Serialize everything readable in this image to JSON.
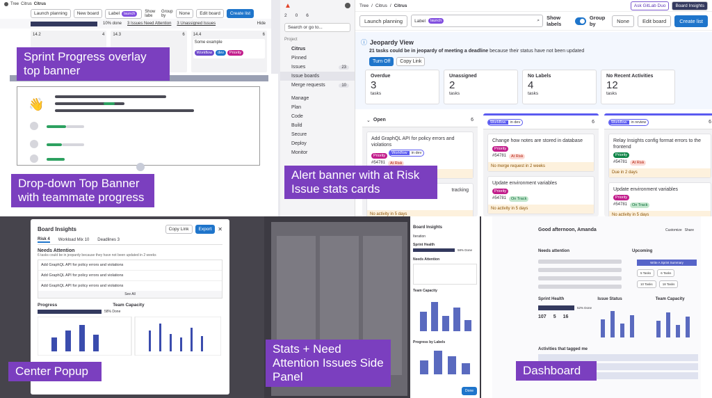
{
  "captions": {
    "sprint": "Sprint Progress overlay top banner",
    "dropdown": "Drop-down Top Banner with teammate progress",
    "alert": "Alert banner with at Risk Issue stats cards",
    "popup": "Center Popup",
    "side": "Stats + Need Attention Issues Side Panel",
    "dashboard": "Dashboard"
  },
  "sprint_tile": {
    "breadcrumb": [
      "Tree",
      "Citrus",
      "Citrus"
    ],
    "launch": "Launch planning",
    "new_board": "New board",
    "label_filter": "Label",
    "label_value": "launch",
    "show_labels": "Show labels",
    "group_by": "Group by",
    "none": "None",
    "edit_board": "Edit board",
    "create_list": "Create list",
    "progress": "10% done",
    "needs_attention": "3 Issues Need Attention",
    "unassigned": "3 Unassigned Issues",
    "hide": "Hide",
    "columns": [
      "14.2",
      "14.3",
      "14.4"
    ],
    "col_counts": [
      "4",
      "6",
      "6"
    ],
    "some_example": "Some example",
    "labels": [
      "Workflow",
      "dev",
      "Priority",
      "design",
      "Workflow",
      "review"
    ]
  },
  "sidebar": {
    "search": "Search or go to...",
    "project": "Project",
    "project_name": "Citrus",
    "pinned": "Pinned",
    "counts": [
      "2",
      "0",
      "6"
    ],
    "items": [
      {
        "label": "Issues",
        "badge": "23"
      },
      {
        "label": "Issue boards",
        "badge": ""
      },
      {
        "label": "Merge requests",
        "badge": "10"
      }
    ],
    "sections": [
      "Manage",
      "Plan",
      "Code",
      "Build",
      "Secure",
      "Deploy",
      "Monitor"
    ]
  },
  "jeopardy": {
    "breadcrumb": [
      "Tree",
      "Citrus",
      "Citrus"
    ],
    "ask_duo": "Ask GitLab Duo",
    "board_insights": "Board Insights",
    "launch": "Launch planning",
    "label_filter": "Label",
    "label_value": "launch",
    "show_labels": "Show labels",
    "group_by": "Group by",
    "none": "None",
    "edit_board": "Edit board",
    "create_list": "Create list",
    "title": "Jeopardy View",
    "message_bold": "21 tasks could be in jeopardy of meeting a deadline",
    "message_rest": " because their status have not been updated",
    "turn_off": "Turn Off",
    "copy_link": "Copy Link",
    "stats": [
      {
        "label": "Overdue",
        "value": "3",
        "sub": "tasks"
      },
      {
        "label": "Unassigned",
        "value": "2",
        "sub": "tasks"
      },
      {
        "label": "No Labels",
        "value": "4",
        "sub": "tasks"
      },
      {
        "label": "No Recent Activities",
        "value": "12",
        "sub": "tasks"
      }
    ],
    "columns": [
      {
        "title": "Open",
        "count": "6",
        "scoped_key": "",
        "scoped_val": "",
        "cards": [
          {
            "title": "Add GraphQL API for policy errors and violations",
            "id": "#54781",
            "status": "At Risk",
            "warn": "No merge request in 2 weeks"
          },
          {
            "title": "tracking",
            "id": "",
            "status": "",
            "warn": "No activity in 5 days"
          }
        ]
      },
      {
        "title": "",
        "count": "6",
        "scoped_key": "Workflow",
        "scoped_val": "in dev",
        "cards": [
          {
            "title": "Change how notes are stored in database",
            "id": "#54781",
            "status": "At Risk",
            "warn": "No merge request in 2 weeks"
          },
          {
            "title": "Update environment variables",
            "id": "#54781",
            "status": "On Track",
            "warn": "No activity in 5 days"
          }
        ]
      },
      {
        "title": "",
        "count": "6",
        "scoped_key": "Workflow",
        "scoped_val": "in review",
        "cards": [
          {
            "title": "Relay Insights config format errors to the frontend",
            "id": "#54781",
            "status": "At Risk",
            "warn": "Due in 2 days"
          },
          {
            "title": "Update environment variables",
            "id": "#54781",
            "status": "On Track",
            "warn": "No activity in 5 days"
          }
        ]
      }
    ]
  },
  "popup": {
    "title": "Board Insights",
    "copy_link": "Copy Link",
    "export": "Export",
    "tabs": [
      "Risk",
      "Workload Mix",
      "Deadlines"
    ],
    "tab_counts": [
      "4",
      "10",
      "3"
    ],
    "needs_attention": "Needs Attention",
    "sub": "6 tasks could be in jeopardy because they have not been updated in 2 weeks",
    "issues": [
      "Add GraphQL API for policy errors and violations",
      "Add GraphQL API for policy errors and violations",
      "Add GraphQL API for policy errors and violations"
    ],
    "see_all": "See All",
    "progress": "Progress",
    "progress_pct": "58% Done",
    "team_capacity": "Team Capacity",
    "incomplete": "Incomplete",
    "grouped_by": "Grouped by",
    "workflow_labels": "Workflow Labels",
    "assigned_by": "Assigned by",
    "all_workflow": "All Workflow",
    "testing": "Testing",
    "assignee": "Assignee"
  },
  "side": {
    "title": "Board Insights",
    "iteration": "Iteration",
    "sprint_health": "Sprint Health",
    "pct": "58% Done",
    "needs_attention": "Needs Attention",
    "team_capacity": "Team Capacity",
    "progress_by_labels": "Progress by Labels",
    "done": "Done"
  },
  "dash": {
    "greeting": "Good afternoon, Amanda",
    "customize": "Customize",
    "share": "Share",
    "needs_attention": "Needs attention",
    "upcoming": "Upcoming",
    "sprint_health": "Sprint Health",
    "issue_status": "Issue Status",
    "team_capacity": "Team Capacity",
    "activities": "Activities that tagged me",
    "stats": [
      "107",
      "5",
      "16"
    ],
    "pct": "52% Done",
    "ai_summary": "Write A Sprint Summary",
    "task_badges": [
      "5 Tasks",
      "6 Tasks",
      "10 Tasks",
      "18 Tasks"
    ]
  },
  "colors": {
    "accent_purple": "#7b3fbf",
    "gitlab_blue": "#1f75cb",
    "risk_red": "#dd2b0e",
    "on_track_green": "#108548",
    "priority_pink": "#c21e8c"
  }
}
